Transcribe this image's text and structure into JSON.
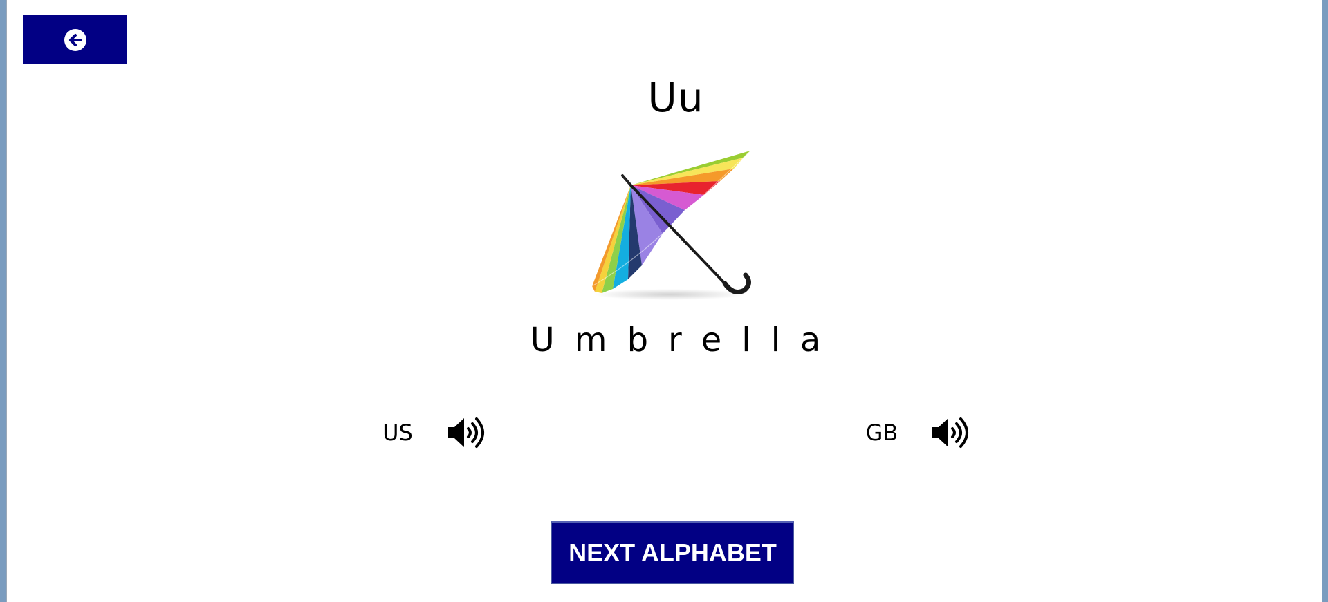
{
  "header": {
    "back_icon": "circle-arrow-left-icon"
  },
  "card": {
    "letter": "Uu",
    "picture_icon": "rainbow-umbrella-image",
    "word": "Umbrella"
  },
  "pronunciation": {
    "us": {
      "label": "US",
      "icon": "speaker-volume-icon"
    },
    "gb": {
      "label": "GB",
      "icon": "speaker-volume-icon"
    }
  },
  "footer": {
    "next_label": "NEXT ALPHABET"
  },
  "colors": {
    "button_bg": "#020084",
    "button_text": "#ffffff",
    "text": "#000000",
    "background": "#ffffff"
  }
}
